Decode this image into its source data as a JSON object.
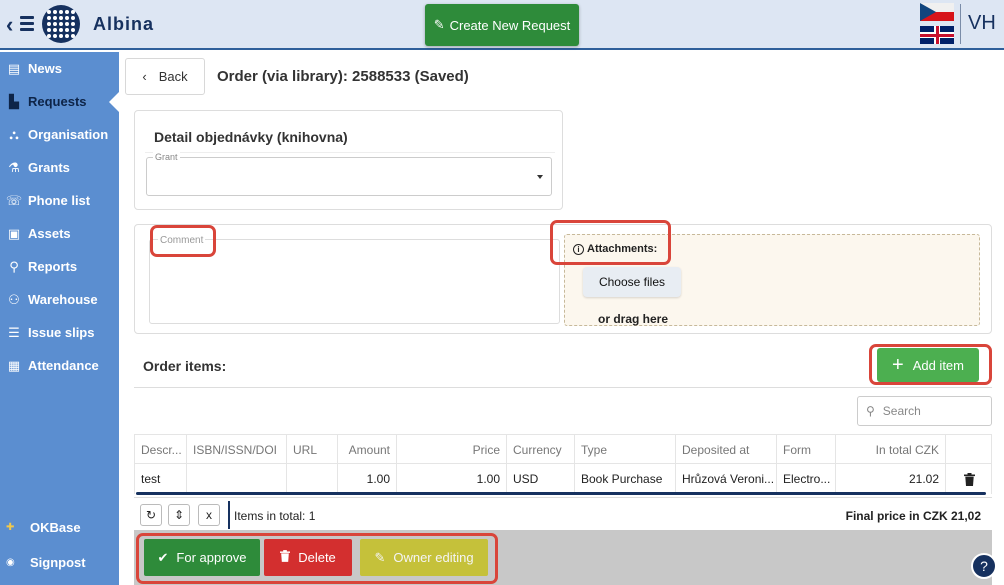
{
  "header": {
    "brand": "Albina",
    "create_button": "Create New Request",
    "user_initials": "VH"
  },
  "sidebar": {
    "items": [
      {
        "label": "News",
        "icon": "newspaper-icon"
      },
      {
        "label": "Requests",
        "icon": "file-icon",
        "active": true
      },
      {
        "label": "Organisation",
        "icon": "sitemap-icon"
      },
      {
        "label": "Grants",
        "icon": "flask-icon"
      },
      {
        "label": "Phone list",
        "icon": "phone-icon"
      },
      {
        "label": "Assets",
        "icon": "briefcase-icon"
      },
      {
        "label": "Reports",
        "icon": "search-icon"
      },
      {
        "label": "Warehouse",
        "icon": "people-carry-icon"
      },
      {
        "label": "Issue slips",
        "icon": "document-list-icon"
      },
      {
        "label": "Attendance",
        "icon": "calendar-icon"
      }
    ],
    "bottom": [
      {
        "label": "OKBase"
      },
      {
        "label": "Signpost"
      }
    ]
  },
  "page": {
    "back_label": "Back",
    "title": "Order (via library): 2588533 (Saved)"
  },
  "detail": {
    "title": "Detail objednávky (knihovna)",
    "grant_label": "Grant",
    "grant_value": ""
  },
  "comment": {
    "label": "Comment",
    "value": ""
  },
  "attachments": {
    "title": "Attachments:",
    "choose_label": "Choose files",
    "drag_label": "or drag here"
  },
  "order_items": {
    "title": "Order items:",
    "add_label": "Add item",
    "search_placeholder": "Search",
    "columns": [
      "Descr...",
      "ISBN/ISSN/DOI",
      "URL",
      "Amount",
      "Price",
      "Currency",
      "Type",
      "Deposited at",
      "Form",
      "In total CZK"
    ],
    "rows": [
      {
        "descr": "test",
        "isbn": "",
        "url": "",
        "amount": "1.00",
        "price": "1.00",
        "currency": "USD",
        "type": "Book Purchase",
        "deposited": "Hrůzová Veroni...",
        "form": "Electro...",
        "total": "21.02"
      }
    ],
    "items_total_label": "Items in total: 1",
    "final_price_label": "Final price in CZK 21,02"
  },
  "actions": {
    "approve": "For approve",
    "delete": "Delete",
    "owner_editing": "Owner editing"
  },
  "colors": {
    "sidebar": "#5b8ed0",
    "primary_green": "#2e8b3a",
    "add_green": "#4caf50",
    "delete_red": "#d32f2f",
    "owner_olive": "#c5c13a",
    "highlight": "#d9453a",
    "navy": "#16315f"
  }
}
